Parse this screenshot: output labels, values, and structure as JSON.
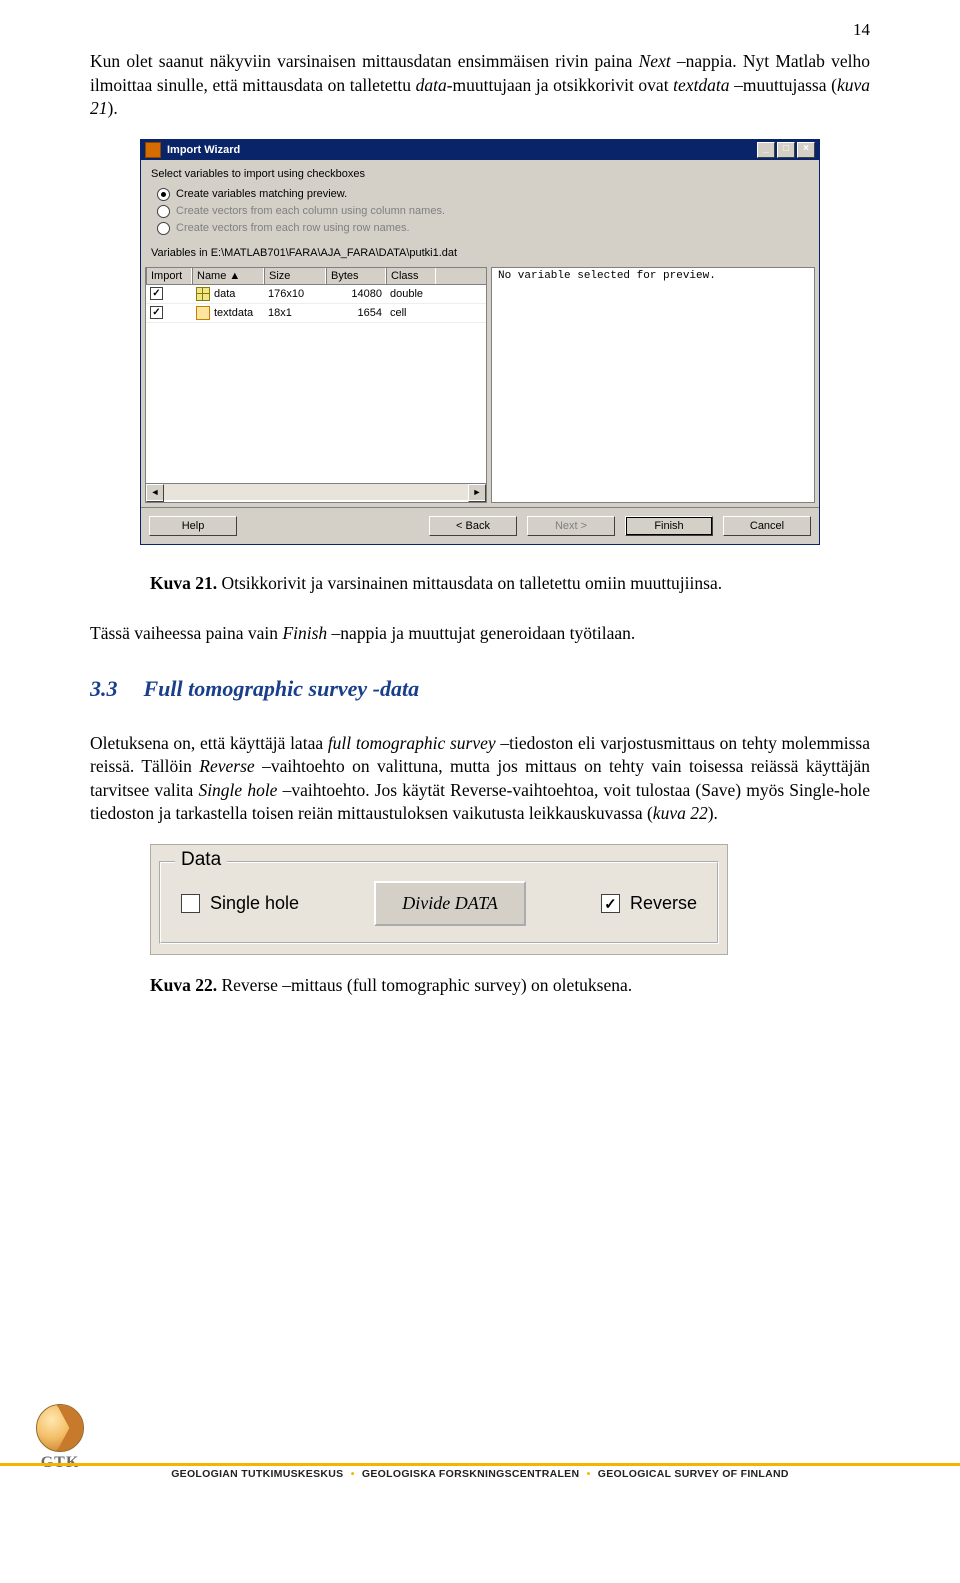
{
  "page_number": "14",
  "para1_parts": [
    {
      "t": "Kun olet saanut näkyviin varsinaisen mittausdatan ensimmäisen rivin paina "
    },
    {
      "t": "Next",
      "i": true
    },
    {
      "t": " –nappia. Nyt Matlab velho ilmoittaa sinulle, että mittausdata on talletettu "
    },
    {
      "t": "data",
      "i": true
    },
    {
      "t": "-muuttujaan ja otsikkorivit ovat "
    },
    {
      "t": "textdata",
      "i": true
    },
    {
      "t": " –muuttujassa ("
    },
    {
      "t": "kuva 21",
      "i": true
    },
    {
      "t": ")."
    }
  ],
  "wizard": {
    "title": "Import Wizard",
    "subtitle": "Select variables to import using checkboxes",
    "radios": [
      {
        "label": "Create variables matching preview.",
        "checked": true,
        "enabled": true
      },
      {
        "label": "Create vectors from each column using column names.",
        "checked": false,
        "enabled": false
      },
      {
        "label": "Create vectors from each row using row names.",
        "checked": false,
        "enabled": false
      }
    ],
    "path_label": "Variables in E:\\MATLAB701\\FARA\\AJA_FARA\\DATA\\putki1.dat",
    "columns": [
      "Import",
      "Name ▲",
      "Size",
      "Bytes",
      "Class"
    ],
    "rows": [
      {
        "checked": true,
        "icon": "data",
        "name": "data",
        "size": "176x10",
        "bytes": "14080",
        "class": "double"
      },
      {
        "checked": true,
        "icon": "cell",
        "name": "textdata",
        "size": "18x1",
        "bytes": "1654",
        "class": "cell"
      }
    ],
    "preview_text": "No variable selected for preview.",
    "buttons": {
      "help": "Help",
      "back": "< Back",
      "next": "Next >",
      "finish": "Finish",
      "cancel": "Cancel"
    }
  },
  "caption21_parts": [
    {
      "t": "Kuva 21.",
      "b": true
    },
    {
      "t": " Otsikkorivit ja varsinainen mittausdata on talletettu omiin muuttujiinsa."
    }
  ],
  "para2_parts": [
    {
      "t": "Tässä vaiheessa paina vain  "
    },
    {
      "t": "Finish",
      "i": true
    },
    {
      "t": " –nappia ja muuttujat generoidaan työtilaan."
    }
  ],
  "section": {
    "num": "3.3",
    "title": "Full tomographic survey -data"
  },
  "para3_parts": [
    {
      "t": "Oletuksena on, että käyttäjä lataa "
    },
    {
      "t": "full tomographic survey",
      "i": true
    },
    {
      "t": " –tiedoston eli varjostusmittaus on tehty molemmissa reissä. Tällöin "
    },
    {
      "t": "Reverse",
      "i": true
    },
    {
      "t": " –vaihtoehto on valittuna, mutta jos mittaus on tehty vain toisessa reiässä käyttäjän tarvitsee valita "
    },
    {
      "t": "Single hole",
      "i": true
    },
    {
      "t": " –vaihtoehto. Jos käytät Reverse-vaihtoehtoa, voit tulostaa (Save) myös Single-hole tiedoston ja tarkastella toisen reiän mittaustuloksen vaikutusta leikkauskuvassa ("
    },
    {
      "t": "kuva 22",
      "i": true
    },
    {
      "t": ")."
    }
  ],
  "datapanel": {
    "legend": "Data",
    "single": "Single hole",
    "divide": "Divide DATA",
    "reverse": "Reverse"
  },
  "caption22_parts": [
    {
      "t": "Kuva 22.",
      "b": true
    },
    {
      "t": " Reverse –mittaus (full tomographic survey) on oletuksena."
    }
  ],
  "footer": {
    "a": "GEOLOGIAN TUTKIMUSKESKUS",
    "b": "GEOLOGISKA FORSKNINGSCENTRALEN",
    "c": "GEOLOGICAL SURVEY OF FINLAND",
    "logo": "GTK"
  }
}
